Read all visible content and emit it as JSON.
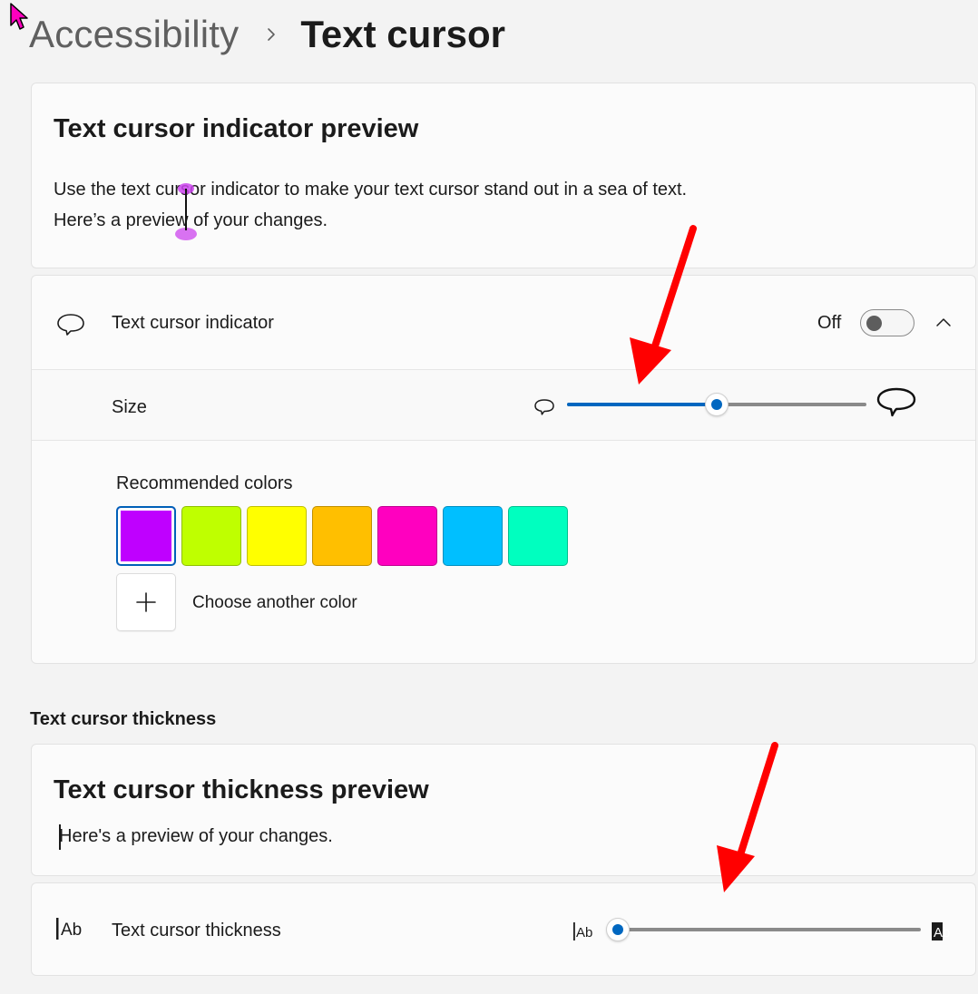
{
  "breadcrumb": {
    "parent": "Accessibility",
    "current": "Text cursor"
  },
  "indicator_preview": {
    "title": "Text cursor indicator preview",
    "description": "Use the text cursor indicator to make your text cursor stand out in a sea of text. Here’s a preview of your changes."
  },
  "indicator": {
    "label": "Text cursor indicator",
    "toggle_state": "Off",
    "size": {
      "label": "Size",
      "value_fraction": 0.5
    },
    "colors": {
      "label": "Recommended colors",
      "swatches": [
        "#bf00ff",
        "#bfff00",
        "#ffff00",
        "#ffbf00",
        "#ff00bf",
        "#00bfff",
        "#00ffbf"
      ],
      "selected_index": 0,
      "add_label": "Choose another color"
    }
  },
  "thickness_section": {
    "header": "Text cursor thickness",
    "preview_title": "Text cursor thickness preview",
    "preview_text": "Here's a preview of your changes.",
    "setting_label": "Text cursor thickness",
    "value_fraction": 0.0,
    "icon_text": "Ab"
  },
  "colors": {
    "accent": "#0067c0",
    "annotation_arrow": "#ff0000",
    "pointer": "#ff00bf"
  },
  "icons": {
    "breadcrumb_separator": "chevron-right-icon",
    "indicator": "speech-bubble-icon",
    "expander": "chevron-up-icon",
    "add_color": "plus-icon",
    "thickness": "cursor-ab-icon"
  }
}
